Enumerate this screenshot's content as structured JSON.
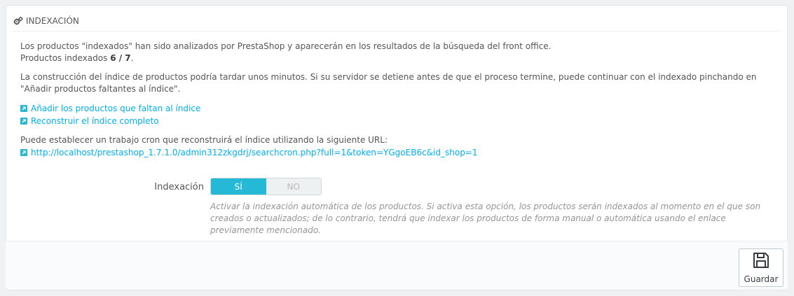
{
  "panel": {
    "title": "INDEXACIÓN",
    "title_icon": "cogs-icon"
  },
  "info": {
    "line1": "Los productos \"indexados\" han sido analizados por PrestaShop y aparecerán en los resultados de la búsqueda del front office.",
    "indexed_label": "Productos indexados ",
    "indexed_count": "6 / 7",
    "indexed_suffix": ".",
    "line3": "La construcción del índice de productos podría tardar unos minutos. Si su servidor se detiene antes de que el proceso termine, puede continuar con el indexado pinchando en \"Añadir productos faltantes al índice\"."
  },
  "links": {
    "add_missing": "Añadir los productos que faltan al índice",
    "rebuild": "Reconstruir el índice completo"
  },
  "cron": {
    "text": "Puede establecer un trabajo cron que reconstruirá el índice utilizando la siguiente URL:",
    "url": "http://localhost/prestashop_1.7.1.0/admin312zkgdrj/searchcron.php?full=1&token=YGgoEB6c&id_shop=1"
  },
  "form": {
    "label": "Indexación",
    "yes": "SÍ",
    "no": "NO",
    "selected": "yes",
    "help": "Activar la indexación automática de los productos. Si activa esta opción, los productos serán indexados al momento en el que son creados o actualizados; de lo contrario, tendrá que indexar los productos de forma manual o automática usando el enlace previamente mencionado."
  },
  "footer": {
    "save_label": "Guardar",
    "save_icon": "save-icon"
  },
  "colors": {
    "accent": "#25b9d7",
    "link": "#00aff0"
  }
}
